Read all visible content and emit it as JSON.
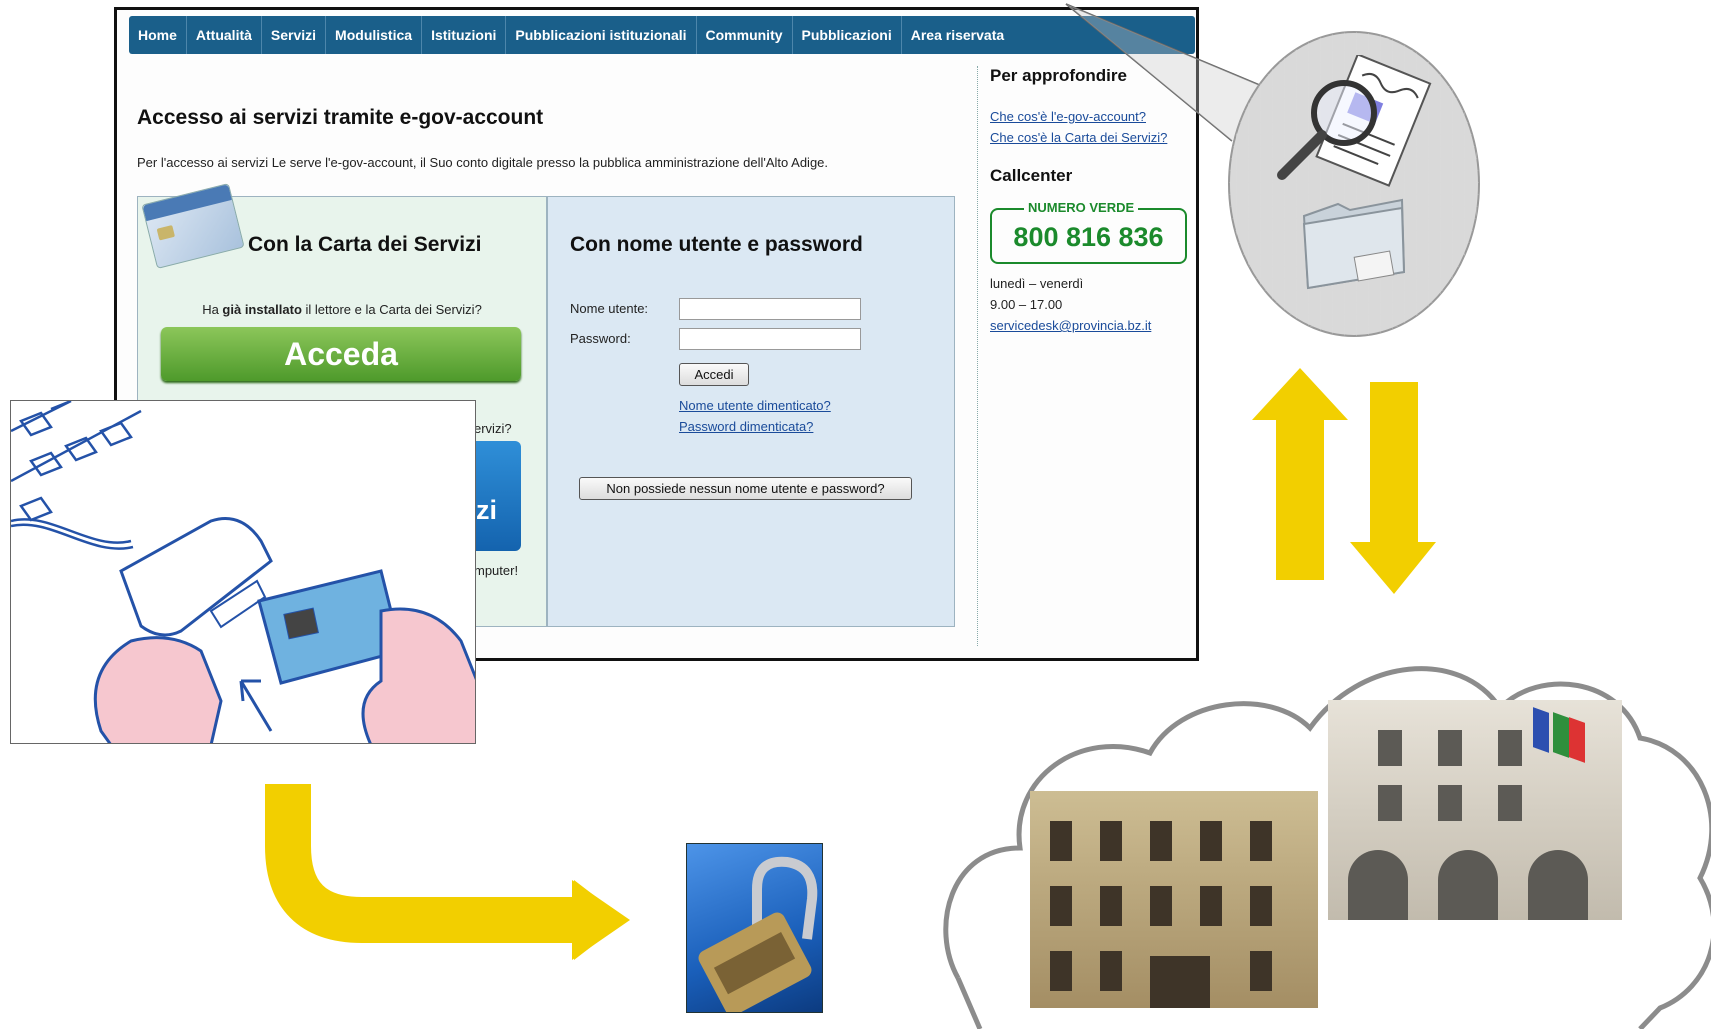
{
  "nav": {
    "items": [
      "Home",
      "Attualità",
      "Servizi",
      "Modulistica",
      "Istituzioni",
      "Pubblicazioni istituzionali",
      "Community",
      "Pubblicazioni",
      "Area riservata"
    ]
  },
  "main": {
    "title": "Accesso ai servizi tramite e-gov-account",
    "intro": "Per l'accesso ai servizi Le serve l'e-gov-account, il Suo conto digitale presso la pubblica amministrazione dell'Alto Adige."
  },
  "card_panel": {
    "title": "Con la Carta dei Servizi",
    "question_prefix": "Ha ",
    "question_bold": "già installato",
    "question_suffix": " il lettore e la Carta dei Servizi?",
    "acceda_label": "Acceda",
    "peek_servizi": "ervizi?",
    "peek_button": "zi",
    "peek_computer": "mputer!"
  },
  "login_panel": {
    "title": "Con nome utente e password",
    "username_label": "Nome utente:",
    "password_label": "Password:",
    "accedi_label": "Accedi",
    "forgot_username": "Nome utente dimenticato?",
    "forgot_password": "Password dimenticata?",
    "no_account_label": "Non possiede nessun nome utente e password?"
  },
  "sidebar": {
    "heading": "Per approfondire",
    "link_egov": "Che cos'è l'e-gov-account?",
    "link_carta": "Che cos'è la Carta dei Servizi?",
    "callcenter": "Callcenter",
    "numero_verde_label": "NUMERO VERDE",
    "numero_verde": "800 816 836",
    "days": "lunedì – venerdì",
    "hours": "9.00 – 17.00",
    "email": "servicedesk@provincia.bz.it"
  },
  "colors": {
    "nav": "#1a5f8a",
    "acceda_green": "#5aa832",
    "verde": "#1b8a2c",
    "link": "#1a4b9a",
    "arrow_yellow": "#f2cf00"
  },
  "icons": [
    "magnifier-document-icon",
    "folder-icon",
    "up-arrow",
    "down-arrow",
    "elbow-arrow",
    "cloud"
  ]
}
